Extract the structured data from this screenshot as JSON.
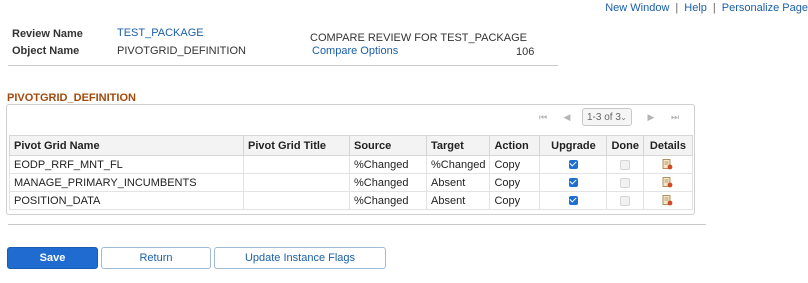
{
  "top_links": {
    "new_window": "New Window",
    "help": "Help",
    "personalize": "Personalize Page",
    "separator": "|"
  },
  "header": {
    "review_name_label": "Review Name",
    "review_name_value": "TEST_PACKAGE",
    "object_name_label": "Object Name",
    "object_name_value": "PIVOTGRID_DEFINITION",
    "compare_title": "COMPARE REVIEW FOR TEST_PACKAGE",
    "compare_options": "Compare Options",
    "count": "106"
  },
  "section_title": "PIVOTGRID_DEFINITION",
  "pager": {
    "range": "1-3 of 3"
  },
  "table": {
    "headers": [
      "Pivot Grid Name",
      "Pivot Grid Title",
      "Source",
      "Target",
      "Action",
      "Upgrade",
      "Done",
      "Details"
    ],
    "rows": [
      {
        "name": "EODP_RRF_MNT_FL",
        "title": "",
        "source": "%Changed",
        "target": "%Changed",
        "action": "Copy",
        "upgrade": true,
        "done": false
      },
      {
        "name": "MANAGE_PRIMARY_INCUMBENTS",
        "title": "",
        "source": "%Changed",
        "target": "Absent",
        "action": "Copy",
        "upgrade": true,
        "done": false
      },
      {
        "name": "POSITION_DATA",
        "title": "",
        "source": "%Changed",
        "target": "Absent",
        "action": "Copy",
        "upgrade": true,
        "done": false
      }
    ]
  },
  "buttons": {
    "save": "Save",
    "return": "Return",
    "update_flags": "Update Instance Flags"
  },
  "colors": {
    "link": "#1a5fa8",
    "primary": "#1f6bd0",
    "section_title": "#a24a0c"
  }
}
